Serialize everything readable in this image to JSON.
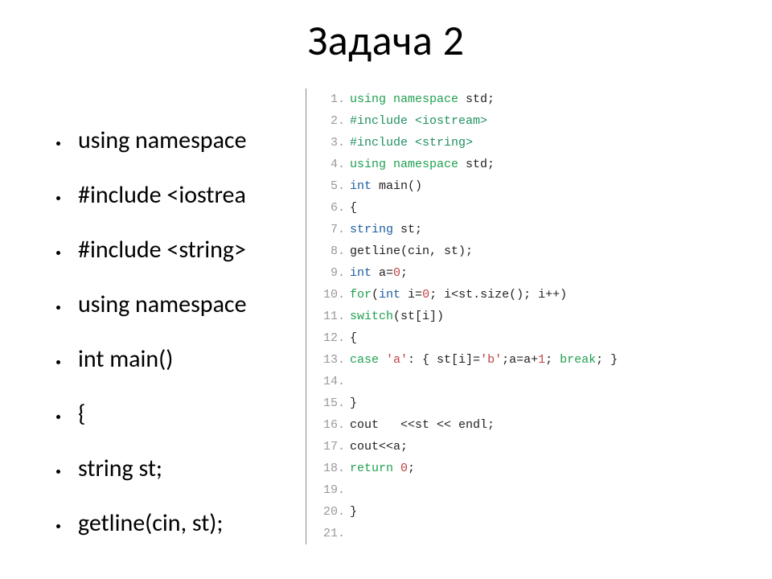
{
  "title": "Задача 2",
  "bullets": [
    "using namespace",
    "#include <iostrea",
    "#include <string>",
    "using namespace",
    "int main()",
    "{",
    "string st;",
    "getline(cin, st);"
  ],
  "code": [
    {
      "n": "1.",
      "spans": [
        [
          "kw",
          "using"
        ],
        [
          "pl",
          " "
        ],
        [
          "kw",
          "namespace"
        ],
        [
          "pl",
          " std;"
        ]
      ]
    },
    {
      "n": "2.",
      "spans": [
        [
          "pre",
          "#include <iostream>"
        ]
      ]
    },
    {
      "n": "3.",
      "spans": [
        [
          "pre",
          "#include <string>"
        ]
      ]
    },
    {
      "n": "4.",
      "spans": [
        [
          "kw",
          "using"
        ],
        [
          "pl",
          " "
        ],
        [
          "kw",
          "namespace"
        ],
        [
          "pl",
          " std;"
        ]
      ]
    },
    {
      "n": "5.",
      "spans": [
        [
          "type",
          "int"
        ],
        [
          "pl",
          " main()"
        ]
      ]
    },
    {
      "n": "6.",
      "spans": [
        [
          "pl",
          "{"
        ]
      ]
    },
    {
      "n": "7.",
      "spans": [
        [
          "type",
          "string"
        ],
        [
          "pl",
          " st;"
        ]
      ]
    },
    {
      "n": "8.",
      "spans": [
        [
          "id",
          "getline"
        ],
        [
          "pl",
          "(cin, st);"
        ]
      ]
    },
    {
      "n": "9.",
      "spans": [
        [
          "type",
          "int"
        ],
        [
          "pl",
          " a="
        ],
        [
          "num",
          "0"
        ],
        [
          "pl",
          ";"
        ]
      ]
    },
    {
      "n": "10.",
      "spans": [
        [
          "kw",
          "for"
        ],
        [
          "pl",
          "("
        ],
        [
          "type",
          "int"
        ],
        [
          "pl",
          " i="
        ],
        [
          "num",
          "0"
        ],
        [
          "pl",
          "; i<st.size(); i++)"
        ]
      ]
    },
    {
      "n": "11.",
      "spans": [
        [
          "kw",
          "switch"
        ],
        [
          "pl",
          "(st[i])"
        ]
      ]
    },
    {
      "n": "12.",
      "spans": [
        [
          "pl",
          "{"
        ]
      ]
    },
    {
      "n": "13.",
      "spans": [
        [
          "kw",
          "case"
        ],
        [
          "pl",
          " "
        ],
        [
          "str",
          "'a'"
        ],
        [
          "pl",
          ": { st[i]="
        ],
        [
          "str",
          "'b'"
        ],
        [
          "pl",
          ";a=a+"
        ],
        [
          "num",
          "1"
        ],
        [
          "pl",
          "; "
        ],
        [
          "kw",
          "break"
        ],
        [
          "pl",
          "; }"
        ]
      ]
    },
    {
      "n": "14.",
      "spans": [
        [
          "pl",
          " "
        ]
      ]
    },
    {
      "n": "15.",
      "spans": [
        [
          "pl",
          "}"
        ]
      ]
    },
    {
      "n": "16.",
      "spans": [
        [
          "id",
          "cout"
        ],
        [
          "pl",
          "   <<st << endl;"
        ]
      ]
    },
    {
      "n": "17.",
      "spans": [
        [
          "id",
          "cout"
        ],
        [
          "pl",
          "<<a;"
        ]
      ]
    },
    {
      "n": "18.",
      "spans": [
        [
          "kw",
          "return"
        ],
        [
          "pl",
          " "
        ],
        [
          "num",
          "0"
        ],
        [
          "pl",
          ";"
        ]
      ]
    },
    {
      "n": "19.",
      "spans": [
        [
          "pl",
          " "
        ]
      ]
    },
    {
      "n": "20.",
      "spans": [
        [
          "pl",
          "}"
        ]
      ]
    },
    {
      "n": "21.",
      "spans": [
        [
          "pl",
          " "
        ]
      ]
    }
  ]
}
